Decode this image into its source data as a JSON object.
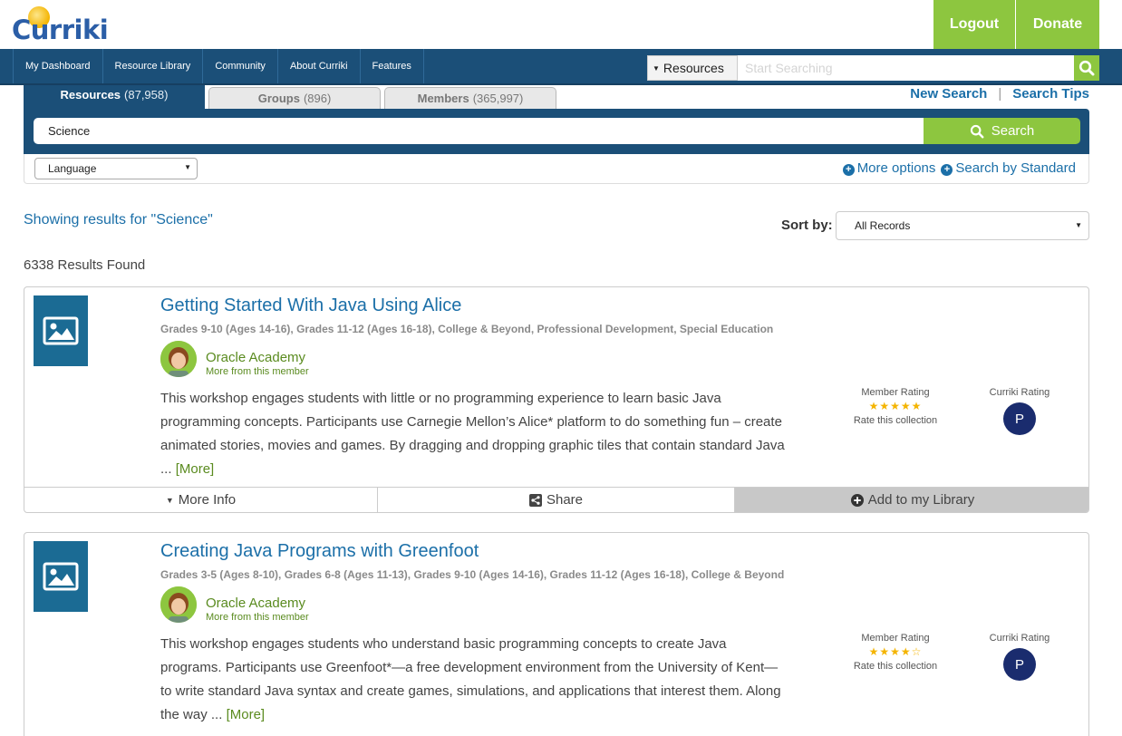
{
  "header": {
    "logo_text": "Curriki",
    "logout_label": "Logout",
    "donate_label": "Donate"
  },
  "nav": {
    "items": [
      "My Dashboard",
      "Resource Library",
      "Community",
      "About Curriki",
      "Features"
    ],
    "search_scope": "Resources",
    "search_placeholder": "Start Searching"
  },
  "tabs": {
    "resources_label": "Resources",
    "resources_count": "(87,958)",
    "groups_label": "Groups",
    "groups_count": "(896)",
    "members_label": "Members",
    "members_count": "(365,997)",
    "new_search": "New Search",
    "separator": "|",
    "search_tips": "Search Tips"
  },
  "search": {
    "query": "Science",
    "button_label": "Search",
    "language_label": "Language",
    "more_options": "More options",
    "search_by_standard": "Search by Standard"
  },
  "results": {
    "showing": "Showing results for \"Science\"",
    "sort_label": "Sort by:",
    "sort_value": "All Records",
    "count_text": "6338 Results Found"
  },
  "cards": [
    {
      "title": "Getting Started With Java Using Alice",
      "grades": "Grades 9-10 (Ages 14-16), Grades 11-12 (Ages 16-18), College & Beyond, Professional Development, Special Education",
      "author": "Oracle Academy",
      "more_from": "More from this member",
      "description": "This workshop engages students with little or no programming experience to learn basic Java programming concepts. Participants use Carnegie Mellon’s Alice* platform to do something fun – create animated stories, movies and games. By dragging and dropping graphic tiles that contain standard Java",
      "ellipsis": "...",
      "more_link": "[More]",
      "member_rating_label": "Member Rating",
      "member_rating": 5,
      "rate_link": "Rate this collection",
      "curriki_rating_label": "Curriki Rating",
      "curriki_rating": "P",
      "more_info": "More Info",
      "share": "Share",
      "add_library": "Add to my Library"
    },
    {
      "title": "Creating Java Programs with Greenfoot",
      "grades": "Grades 3-5 (Ages 8-10), Grades 6-8 (Ages 11-13), Grades 9-10 (Ages 14-16), Grades 11-12 (Ages 16-18), College & Beyond",
      "author": "Oracle Academy",
      "more_from": "More from this member",
      "description": "This workshop engages students who understand basic programming concepts to create Java programs. Participants use Greenfoot*—a free development environment from the University of Kent—to write standard Java syntax and create games, simulations, and applications that interest them. Along the way",
      "ellipsis": "...",
      "more_link": "[More]",
      "member_rating_label": "Member Rating",
      "member_rating": 4,
      "rate_link": "Rate this collection",
      "curriki_rating_label": "Curriki Rating",
      "curriki_rating": "P"
    }
  ],
  "colors": {
    "navy": "#1b4f78",
    "green": "#8dc63f",
    "link_blue": "#1b6fa8",
    "author_green": "#5a8b1f",
    "star_gold": "#f4b400"
  }
}
